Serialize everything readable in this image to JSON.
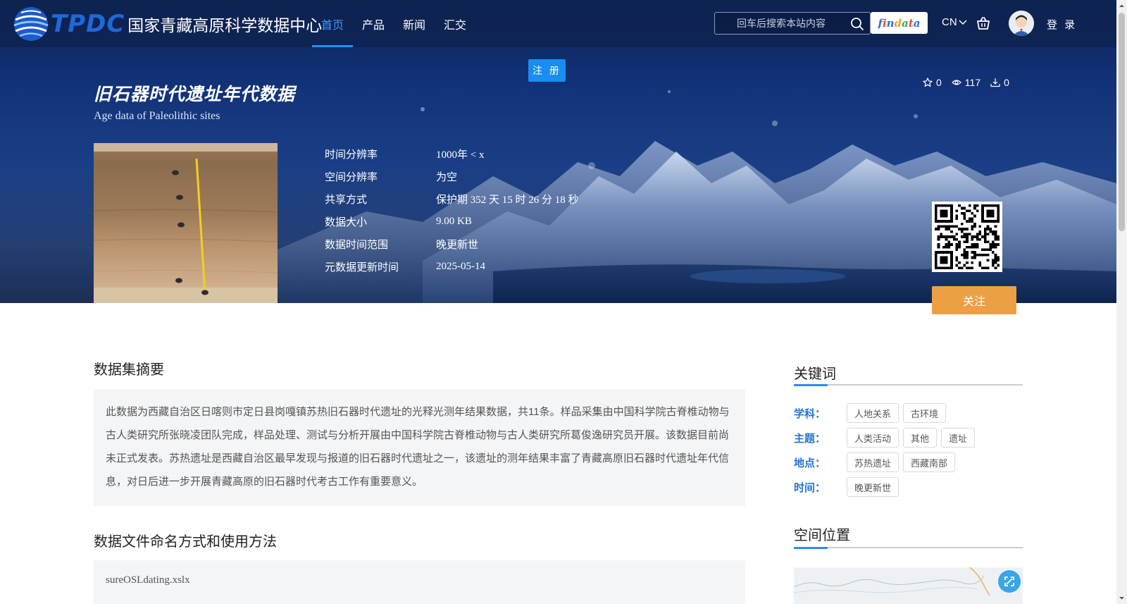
{
  "header": {
    "logo_brand": "TPDC",
    "logo_name": "国家青藏高原科学数据中心",
    "nav": [
      {
        "label": "首页",
        "active": true
      },
      {
        "label": "产品",
        "active": false
      },
      {
        "label": "新闻",
        "active": false
      },
      {
        "label": "汇交",
        "active": false
      }
    ],
    "search_placeholder": "回车后搜索本站内容",
    "findata_label": "findata",
    "lang_label": "CN",
    "login_label": "登 录",
    "register_label": "注 册"
  },
  "dataset": {
    "title_cn": "旧石器时代遗址年代数据",
    "title_en": "Age data of Paleolithic sites",
    "stars": "0",
    "views": "117",
    "downloads": "0",
    "meta": [
      {
        "label": "时间分辨率",
        "value": "1000年 < x"
      },
      {
        "label": "空间分辨率",
        "value": "为空"
      },
      {
        "label": "共享方式",
        "value": "保护期 352 天 15 时 26 分 18 秒"
      },
      {
        "label": "数据大小",
        "value": "9.00 KB"
      },
      {
        "label": "数据时间范围",
        "value": "晚更新世"
      },
      {
        "label": "元数据更新时间",
        "value": "2025-05-14"
      }
    ],
    "follow_label": "关注"
  },
  "main": {
    "abstract_title": "数据集摘要",
    "abstract_text": "此数据为西藏自治区日喀则市定日县岗嘎镇苏热旧石器时代遗址的光释光测年结果数据，共11条。样品采集由中国科学院古脊椎动物与古人类研究所张晓凌团队完成，样品处理、测试与分析开展由中国科学院古脊椎动物与古人类研究所葛俊逸研究员开展。该数据目前尚未正式发表。苏热遗址是西藏自治区最早发现与报道的旧石器时代遗址之一，该遗址的测年结果丰富了青藏高原旧石器时代遗址年代信息，对日后进一步开展青藏高原的旧石器时代考古工作有重要意义。",
    "files_title": "数据文件命名方式和使用方法",
    "files_text": "sureOSLdating.xslx"
  },
  "sidebar": {
    "keywords_title": "关键词",
    "keyword_groups": [
      {
        "label": "学科：",
        "tags": [
          "人地关系",
          "古环境"
        ]
      },
      {
        "label": "主题：",
        "tags": [
          "人类活动",
          "其他",
          "遗址"
        ]
      },
      {
        "label": "地点：",
        "tags": [
          "苏热遗址",
          "西藏南部"
        ]
      },
      {
        "label": "时间：",
        "tags": [
          "晚更新世"
        ]
      }
    ],
    "location_title": "空间位置"
  },
  "colors": {
    "accent": "#2d8cf0",
    "follow": "#eda043",
    "keyword_label": "#2573d6"
  }
}
